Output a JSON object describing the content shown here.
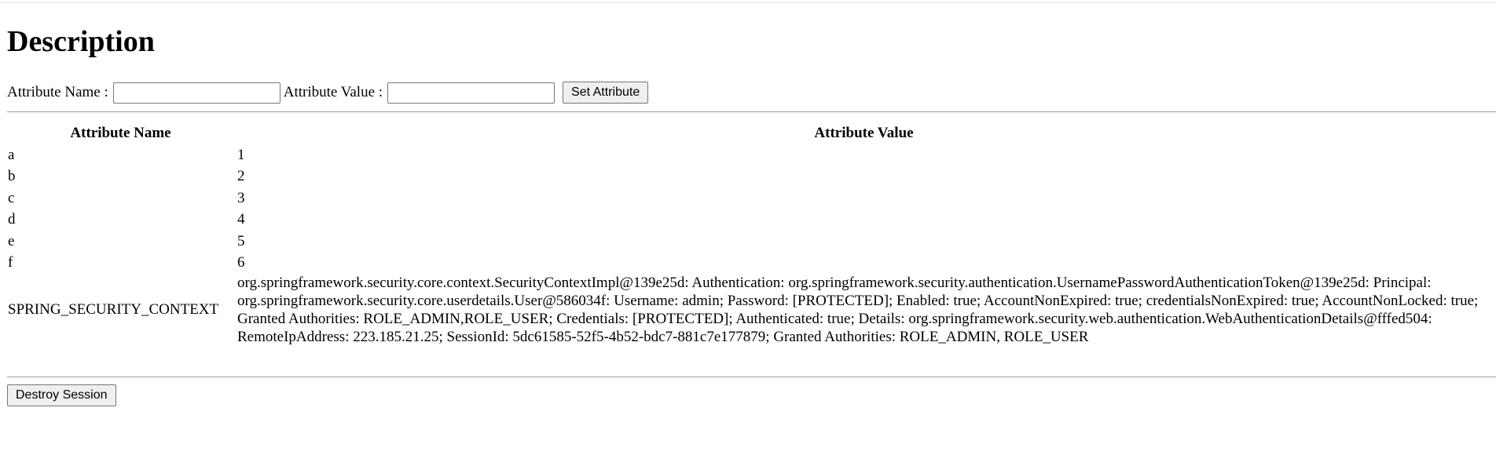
{
  "page": {
    "heading": "Description"
  },
  "form": {
    "name_label": "Attribute Name :",
    "name_value": "",
    "value_label": "Attribute Value :",
    "value_value": "",
    "set_button": "Set Attribute"
  },
  "table": {
    "headers": [
      "Attribute Name",
      "Attribute Value"
    ],
    "rows": [
      {
        "name": "a",
        "value": "1"
      },
      {
        "name": "b",
        "value": "2"
      },
      {
        "name": "c",
        "value": "3"
      },
      {
        "name": "d",
        "value": "4"
      },
      {
        "name": "e",
        "value": "5"
      },
      {
        "name": "f",
        "value": "6"
      },
      {
        "name": "SPRING_SECURITY_CONTEXT",
        "value": "org.springframework.security.core.context.SecurityContextImpl@139e25d: Authentication: org.springframework.security.authentication.UsernamePasswordAuthenticationToken@139e25d: Principal: org.springframework.security.core.userdetails.User@586034f: Username: admin; Password: [PROTECTED]; Enabled: true; AccountNonExpired: true; credentialsNonExpired: true; AccountNonLocked: true; Granted Authorities: ROLE_ADMIN,ROLE_USER; Credentials: [PROTECTED]; Authenticated: true; Details: org.springframework.security.web.authentication.WebAuthenticationDetails@fffed504: RemoteIpAddress: 223.185.21.25; SessionId: 5dc61585-52f5-4b52-bdc7-881c7e177879; Granted Authorities: ROLE_ADMIN, ROLE_USER"
      }
    ]
  },
  "actions": {
    "destroy_button": "Destroy Session"
  }
}
